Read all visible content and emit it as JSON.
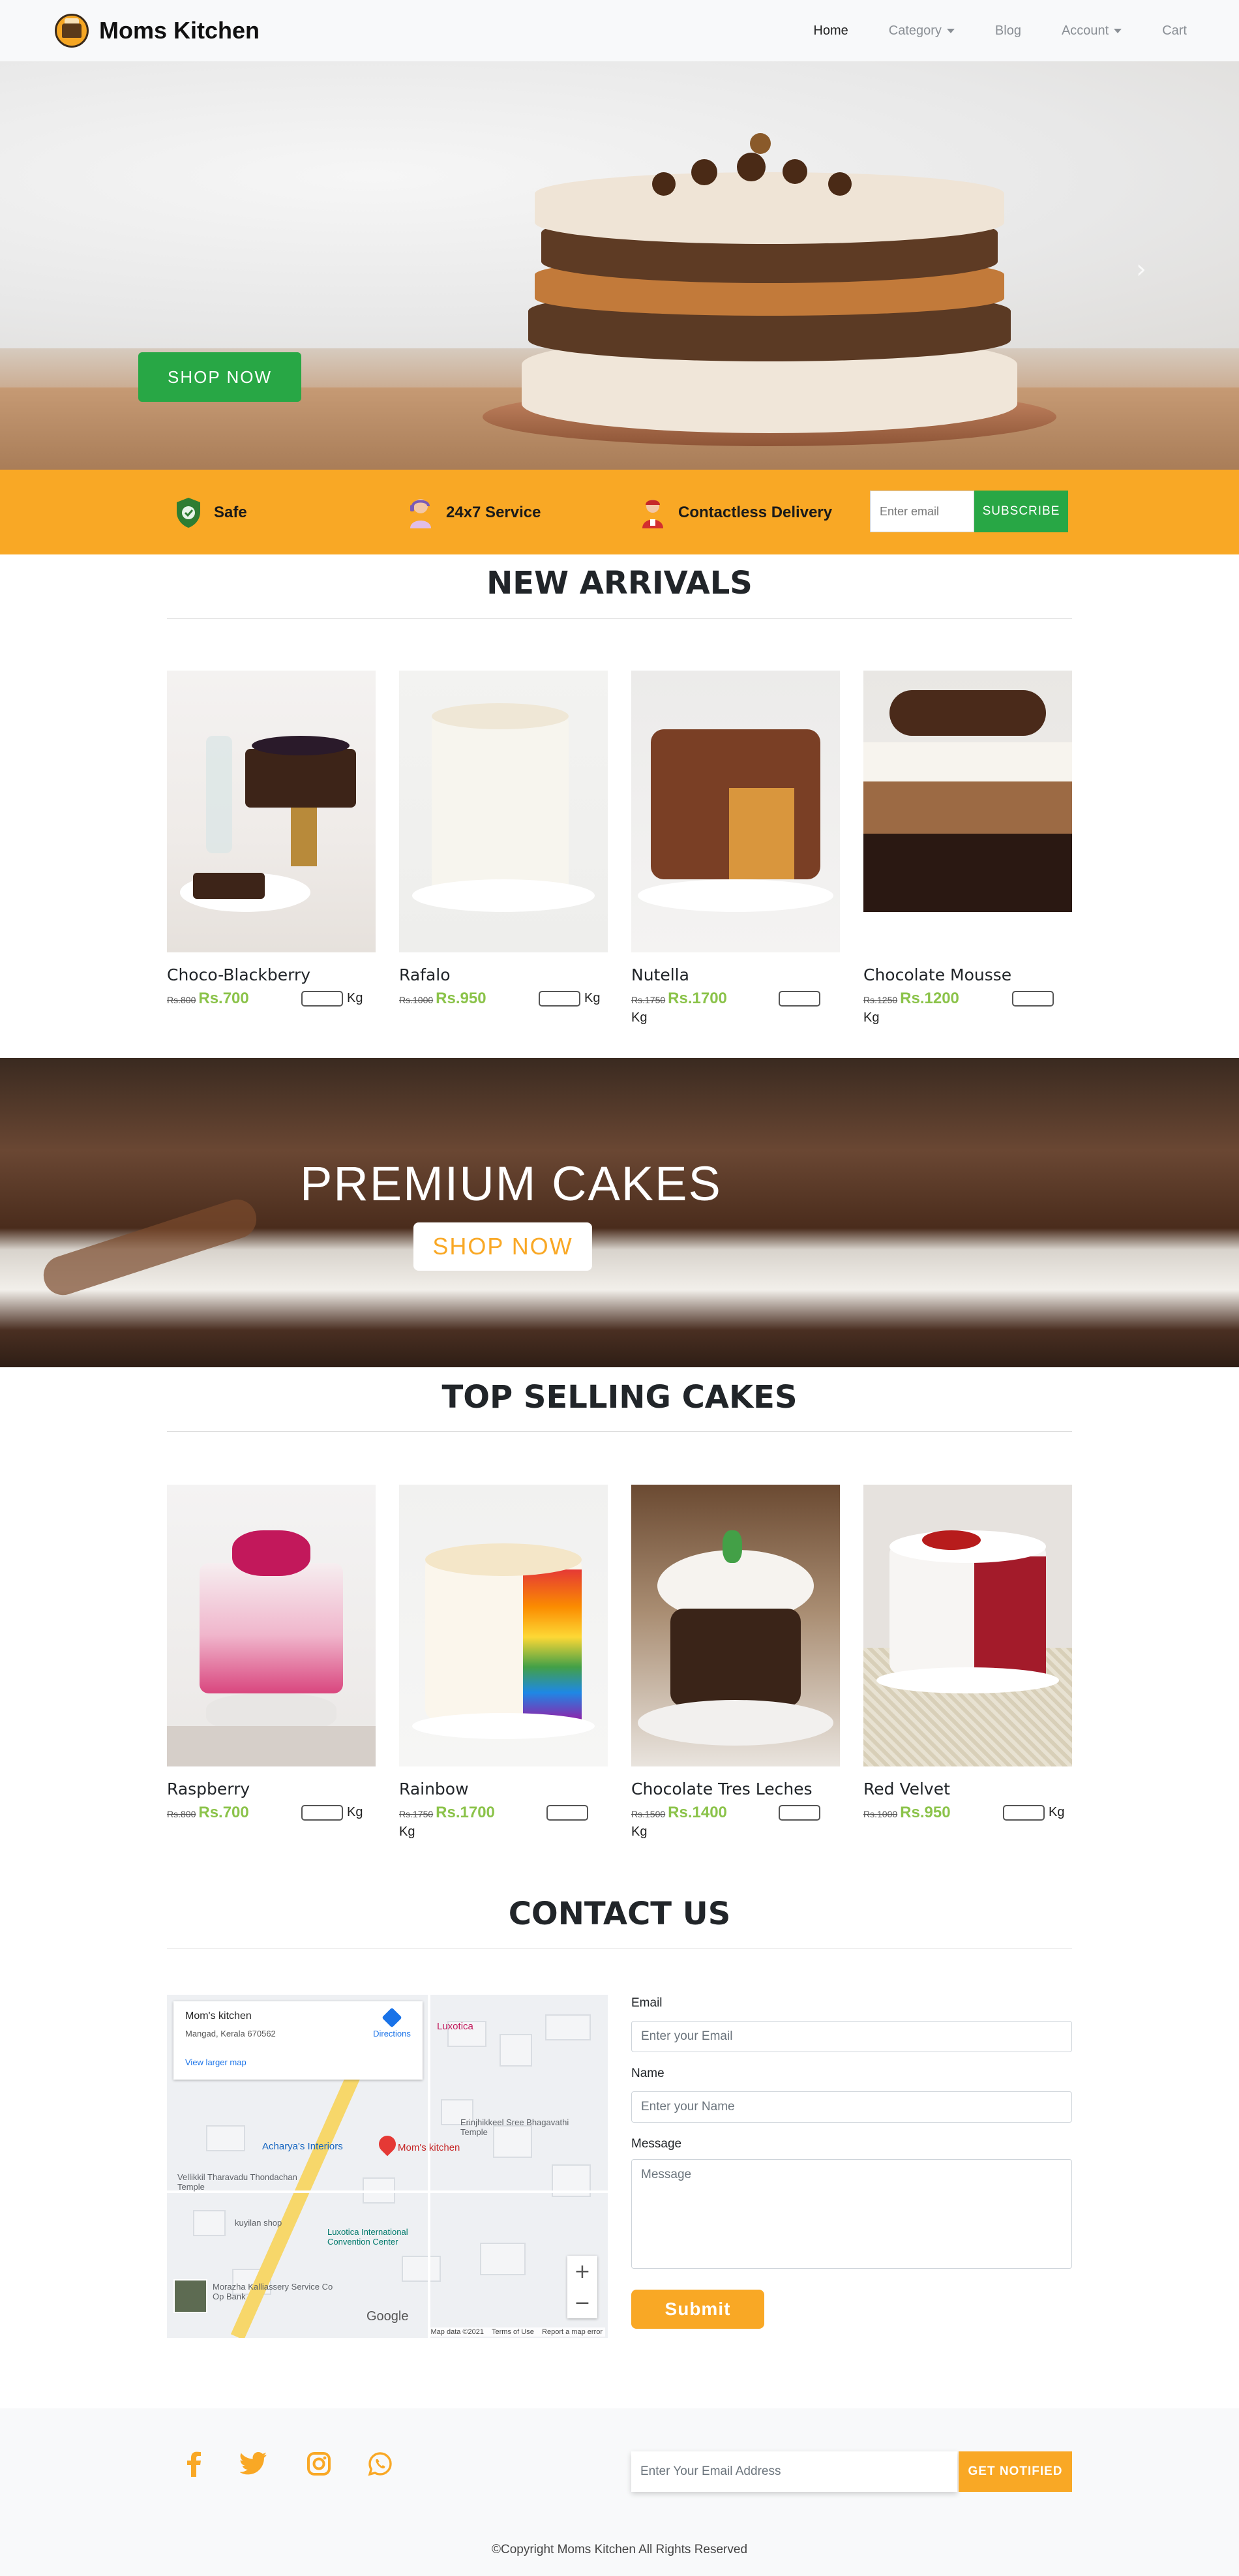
{
  "brand": {
    "name": "Moms Kitchen"
  },
  "nav": {
    "items": [
      {
        "label": "Home",
        "active": true,
        "dropdown": false
      },
      {
        "label": "Category",
        "active": false,
        "dropdown": true
      },
      {
        "label": "Blog",
        "active": false,
        "dropdown": false
      },
      {
        "label": "Account",
        "active": false,
        "dropdown": true
      },
      {
        "label": "Cart",
        "active": false,
        "dropdown": false
      }
    ]
  },
  "hero": {
    "button_label": "SHOP NOW",
    "next_icon": "chevron-right-icon"
  },
  "features": {
    "items": [
      {
        "label": "Safe",
        "icon": "shield-check-icon"
      },
      {
        "label": "24x7 Service",
        "icon": "support-agent-icon"
      },
      {
        "label": "Contactless Delivery",
        "icon": "delivery-person-icon"
      }
    ],
    "subscribe": {
      "placeholder": "Enter email",
      "button_label": "SUBSCRIBE"
    }
  },
  "new_arrivals": {
    "title": "NEW ARRIVALS",
    "products": [
      {
        "name": "Choco-Blackberry",
        "old_price": "Rs.800",
        "price": "Rs.700",
        "unit": "Kg"
      },
      {
        "name": "Rafalo",
        "old_price": "Rs.1000",
        "price": "Rs.950",
        "unit": "Kg"
      },
      {
        "name": "Nutella",
        "old_price": "Rs.1750",
        "price": "Rs.1700",
        "unit": "Kg"
      },
      {
        "name": "Chocolate Mousse",
        "old_price": "Rs.1250",
        "price": "Rs.1200",
        "unit": "Kg"
      }
    ]
  },
  "premium": {
    "title": "PREMIUM CAKES",
    "button_label": "SHOP NOW"
  },
  "top_selling": {
    "title": "TOP SELLING CAKES",
    "products": [
      {
        "name": "Raspberry",
        "old_price": "Rs.800",
        "price": "Rs.700",
        "unit": "Kg"
      },
      {
        "name": "Rainbow",
        "old_price": "Rs.1750",
        "price": "Rs.1700",
        "unit": "Kg"
      },
      {
        "name": "Chocolate Tres Leches",
        "old_price": "Rs.1500",
        "price": "Rs.1400",
        "unit": "Kg"
      },
      {
        "name": "Red Velvet",
        "old_price": "Rs.1000",
        "price": "Rs.950",
        "unit": "Kg"
      }
    ]
  },
  "contact": {
    "title": "CONTACT US",
    "map": {
      "place_name": "Mom's kitchen",
      "address": "Mangad, Kerala 670562",
      "larger_map_link": "View larger map",
      "directions_label": "Directions",
      "pin_label": "Mom's kitchen",
      "labels": [
        "Luxotica",
        "Acharya's Interiors",
        "Erinjhikkeel Sree Bhagavathi Temple",
        "Vellikkil Tharavadu Thondachan Temple",
        "kuyilan shop",
        "Luxotica International Convention Center",
        "Morazha Kalliassery Service Co Op Bank"
      ],
      "attribution": "Map data ©2021",
      "terms": "Terms of Use",
      "report": "Report a map error",
      "logo": "Google",
      "zoom_in": "+",
      "zoom_out": "−"
    },
    "form": {
      "email_label": "Email",
      "email_placeholder": "Enter your Email",
      "name_label": "Name",
      "name_placeholder": "Enter your Name",
      "message_label": "Message",
      "message_placeholder": "Message",
      "submit_label": "Submit"
    }
  },
  "footer": {
    "social": [
      "facebook-icon",
      "twitter-icon",
      "instagram-icon",
      "whatsapp-icon"
    ],
    "notify_placeholder": "Enter Your Email Address",
    "notify_button": "GET NOTIFIED",
    "copyright": "©Copyright Moms Kitchen All Rights Reserved"
  },
  "colors": {
    "accent": "#f9a825",
    "green": "#28a745",
    "price_green": "#8bc34a"
  }
}
